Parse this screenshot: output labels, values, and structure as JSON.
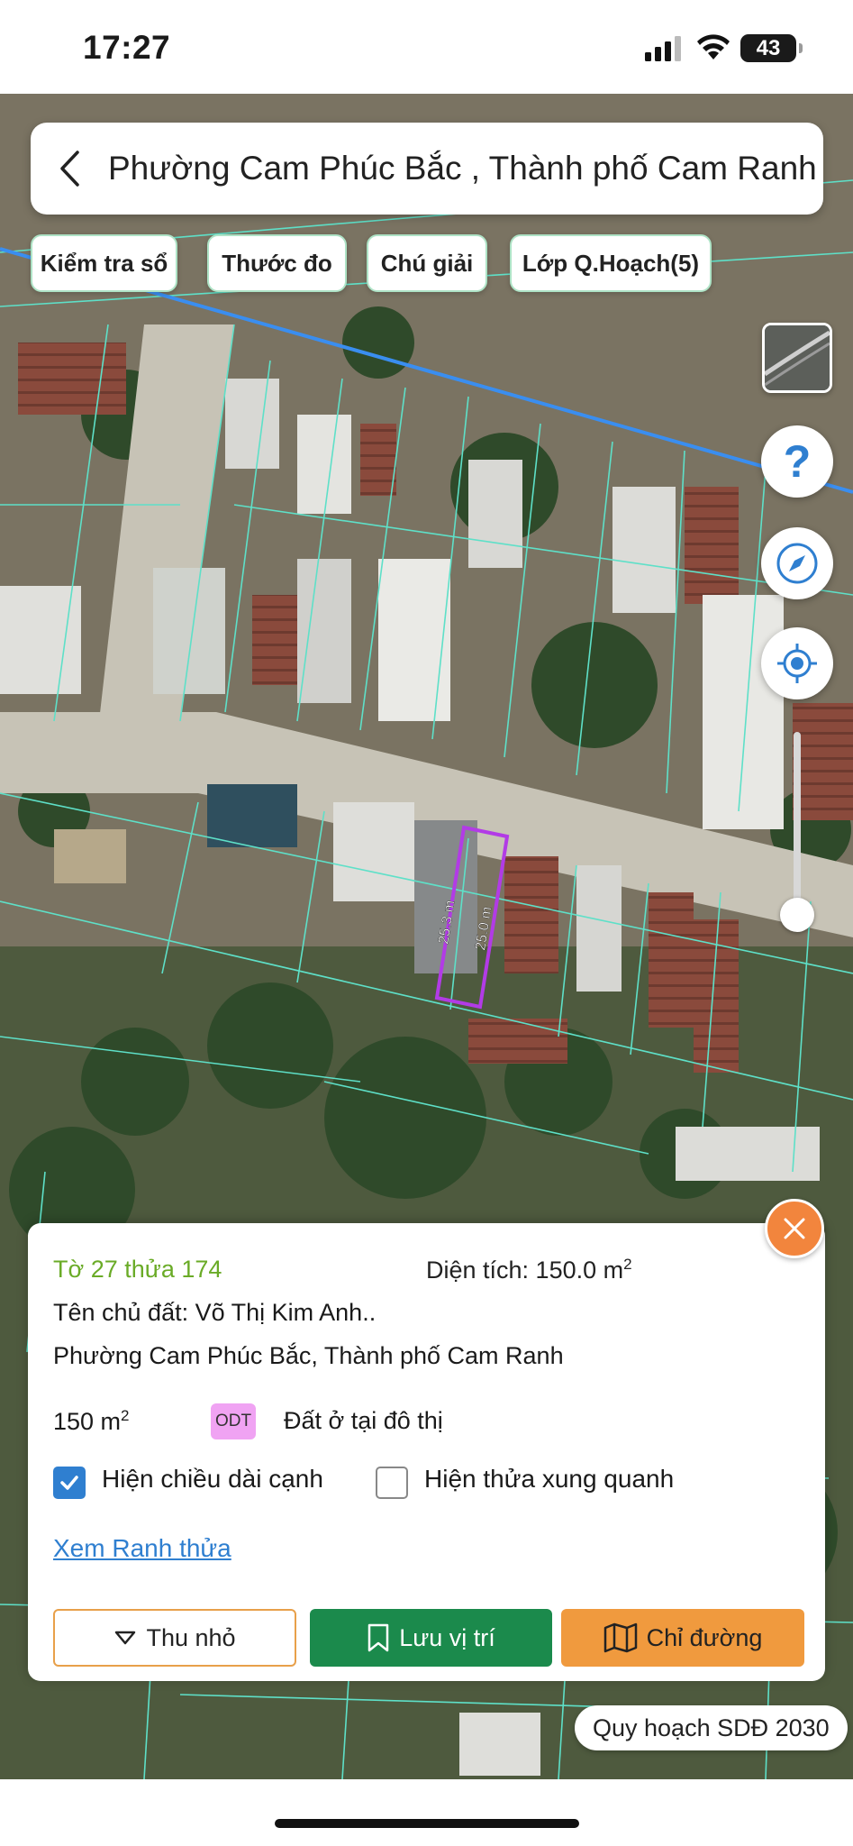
{
  "status_bar": {
    "time": "17:27",
    "battery": "43"
  },
  "header": {
    "title": "Phường Cam Phúc Bắc , Thành phố Cam Ranh"
  },
  "toolbar": {
    "chips": [
      "Kiểm tra sổ",
      "Thước đo",
      "Chú giải",
      "Lớp Q.Hoạch(5)"
    ]
  },
  "map": {
    "parcel_edge_1": "25.3 m",
    "parcel_edge_2": "25.0 m",
    "colors": {
      "parcel_outline": "#b23be6",
      "boundary": "#5ee0c8",
      "planning_line": "#3a8ef0"
    }
  },
  "info": {
    "parcel_id": "Tờ 27 thửa 174",
    "area_label": "Diện tích: 150.0 m",
    "area_sup": "2",
    "owner": "Tên chủ đất: Võ Thị Kim Anh..",
    "address": "Phường Cam Phúc Bắc, Thành phố Cam Ranh",
    "area_value": "150 m",
    "area_value_sup": "2",
    "land_code": "ODT",
    "land_use": "Đất ở tại đô thị",
    "show_edge_lengths": {
      "label": "Hiện chiều dài cạnh",
      "checked": true
    },
    "show_neighbors": {
      "label": "Hiện thửa xung quanh",
      "checked": false
    },
    "view_boundary_link": "Xem Ranh thửa",
    "buttons": {
      "shrink": "Thu nhỏ",
      "save": "Lưu vị trí",
      "route": "Chỉ đường"
    }
  },
  "plan_label": "Quy hoạch SDĐ 2030",
  "icons": [
    "back-icon",
    "help-icon",
    "compass-icon",
    "locate-icon",
    "close-icon",
    "chevron-down-icon",
    "bookmark-icon",
    "map-icon",
    "checkmark-icon"
  ]
}
